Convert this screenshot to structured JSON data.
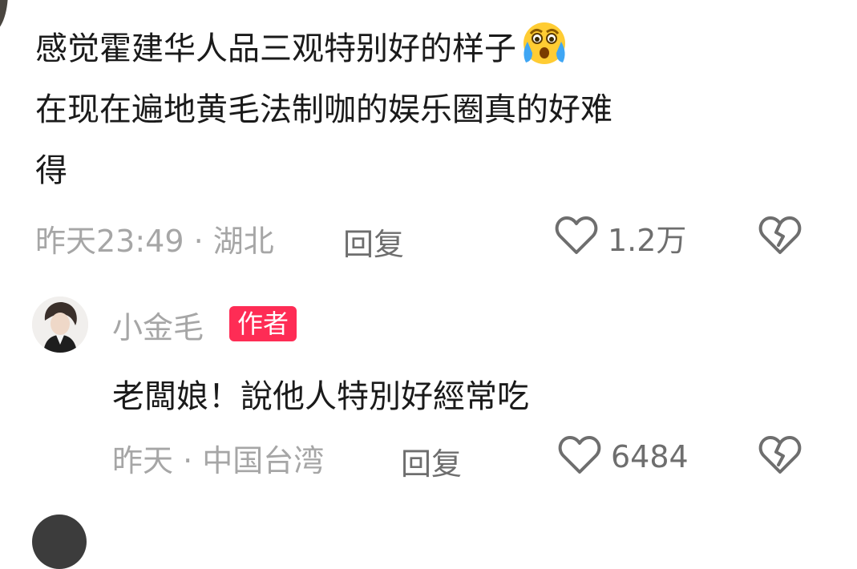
{
  "comment": {
    "text": "感觉霍建华人品三观特别好的样子",
    "text_line2": "在现在遍地黄毛法制咖的娱乐圈真的好难",
    "text_line3": "得",
    "emoji": "crying-laughing-emoji",
    "time_location": "昨天23:49 · 湖北",
    "reply_label": "回复",
    "likes": "1.2万"
  },
  "reply": {
    "username": "小金毛",
    "badge": "作者",
    "text": "老闆娘！說他人特別好經常吃",
    "time_location": "昨天 · 中国台湾",
    "reply_label": "回复",
    "likes": "6484"
  },
  "colors": {
    "meta_gray": "#a6a6a6",
    "action_gray": "#6e6e6e",
    "badge_red": "#fe2c55",
    "text": "#1a1a1a"
  }
}
